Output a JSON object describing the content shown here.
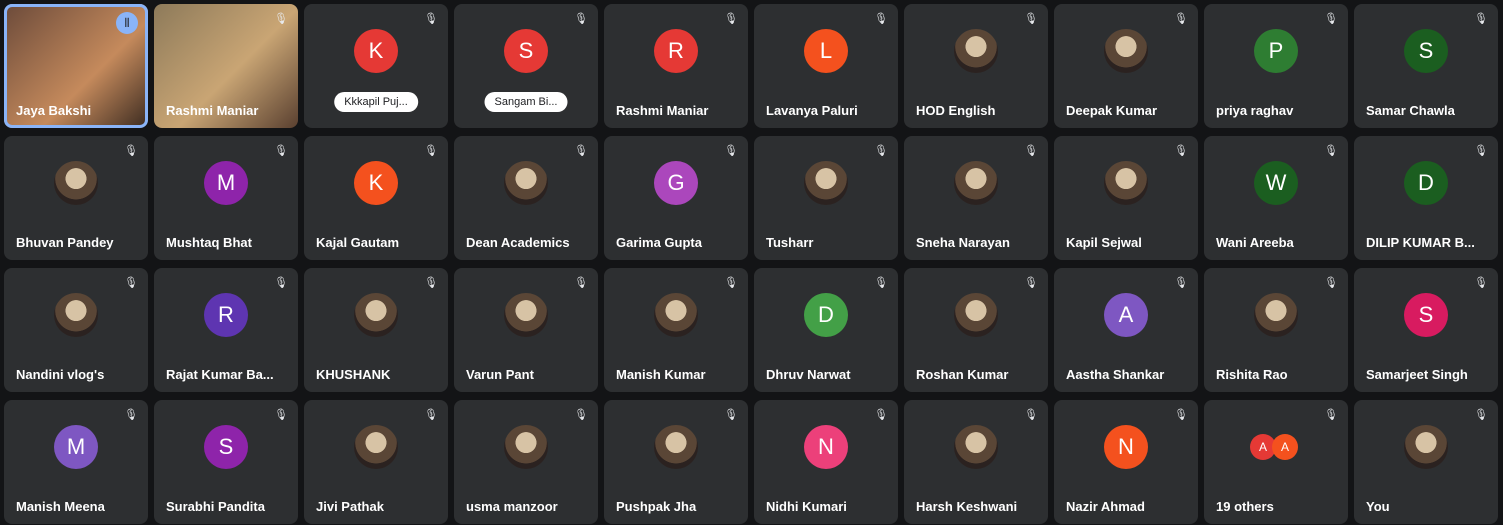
{
  "participants": [
    {
      "name": "Jaya Bakshi",
      "type": "video",
      "active": true
    },
    {
      "name": "Rashmi Maniar",
      "type": "video2"
    },
    {
      "name": "",
      "letter": "K",
      "color": "#e53935",
      "pill": "Kkkapil Puj..."
    },
    {
      "name": "",
      "letter": "S",
      "color": "#e53935",
      "pill": "Sangam Bi..."
    },
    {
      "name": "Rashmi Maniar",
      "letter": "R",
      "color": "#e53935"
    },
    {
      "name": "Lavanya Paluri",
      "letter": "L",
      "color": "#f4511e"
    },
    {
      "name": "HOD English",
      "photo": true
    },
    {
      "name": "Deepak Kumar",
      "photo": true
    },
    {
      "name": "priya raghav",
      "letter": "P",
      "color": "#2e7d32"
    },
    {
      "name": "Samar Chawla",
      "letter": "S",
      "color": "#1b5e20"
    },
    {
      "name": "Bhuvan Pandey",
      "photo": true
    },
    {
      "name": "Mushtaq Bhat",
      "letter": "M",
      "color": "#8e24aa"
    },
    {
      "name": "Kajal Gautam",
      "letter": "K",
      "color": "#f4511e"
    },
    {
      "name": "Dean Academics",
      "photo": true
    },
    {
      "name": "Garima Gupta",
      "letter": "G",
      "color": "#ab47bc"
    },
    {
      "name": "Tusharr",
      "photo": true
    },
    {
      "name": "Sneha Narayan",
      "photo": true
    },
    {
      "name": "Kapil Sejwal",
      "photo": true
    },
    {
      "name": "Wani Areeba",
      "letter": "W",
      "color": "#1b5e20"
    },
    {
      "name": "DILIP KUMAR B...",
      "letter": "D",
      "color": "#1b5e20"
    },
    {
      "name": "Nandini vlog's",
      "photo": true
    },
    {
      "name": "Rajat Kumar Ba...",
      "letter": "R",
      "color": "#5e35b1"
    },
    {
      "name": "KHUSHANK",
      "photo": true
    },
    {
      "name": "Varun Pant",
      "photo": true
    },
    {
      "name": "Manish Kumar",
      "photo": true
    },
    {
      "name": "Dhruv Narwat",
      "letter": "D",
      "color": "#43a047"
    },
    {
      "name": "Roshan Kumar",
      "photo": true
    },
    {
      "name": "Aastha Shankar",
      "letter": "A",
      "color": "#7e57c2"
    },
    {
      "name": "Rishita Rao",
      "photo": true
    },
    {
      "name": "Samarjeet Singh",
      "letter": "S",
      "color": "#d81b60"
    },
    {
      "name": "Manish Meena",
      "letter": "M",
      "color": "#7e57c2"
    },
    {
      "name": "Surabhi Pandita",
      "letter": "S",
      "color": "#8e24aa"
    },
    {
      "name": "Jivi Pathak",
      "photo": true
    },
    {
      "name": "usma manzoor",
      "photo": true
    },
    {
      "name": "Pushpak Jha",
      "photo": true
    },
    {
      "name": "Nidhi Kumari",
      "letter": "N",
      "color": "#ec407a"
    },
    {
      "name": "Harsh Keshwani",
      "photo": true
    },
    {
      "name": "Nazir Ahmad",
      "letter": "N",
      "color": "#f4511e"
    },
    {
      "name": "19 others",
      "others": true
    },
    {
      "name": "You",
      "photo": true
    }
  ],
  "icons": {
    "mic_off": "mic-off-icon",
    "speaking": "speaking-indicator-icon"
  }
}
